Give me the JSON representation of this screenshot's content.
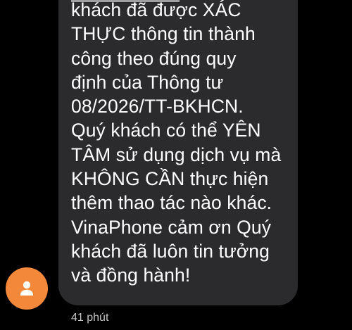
{
  "message": {
    "text": "khách đã được XÁC\nTHỰC thông tin thành\ncông theo đúng quy\nđịnh của Thông tư\n08/2026/TT-BKHCN.\nQuý khách có thể YÊN\nTÂM sử dụng dịch vụ mà\nKHÔNG CẦN thực hiện\nthêm thao tác nào khác.\nVinaPhone cảm ơn Quý\nkhách đã luôn tin tưởng\nvà đồng hành!",
    "timestamp": "41 phút"
  },
  "sender": {
    "avatar_icon": "person-icon",
    "avatar_color": "#f4883a"
  },
  "colors": {
    "background": "#000000",
    "bubble": "#2b2b2e",
    "text": "#ffffff",
    "timestamp": "#c4c4c6"
  }
}
